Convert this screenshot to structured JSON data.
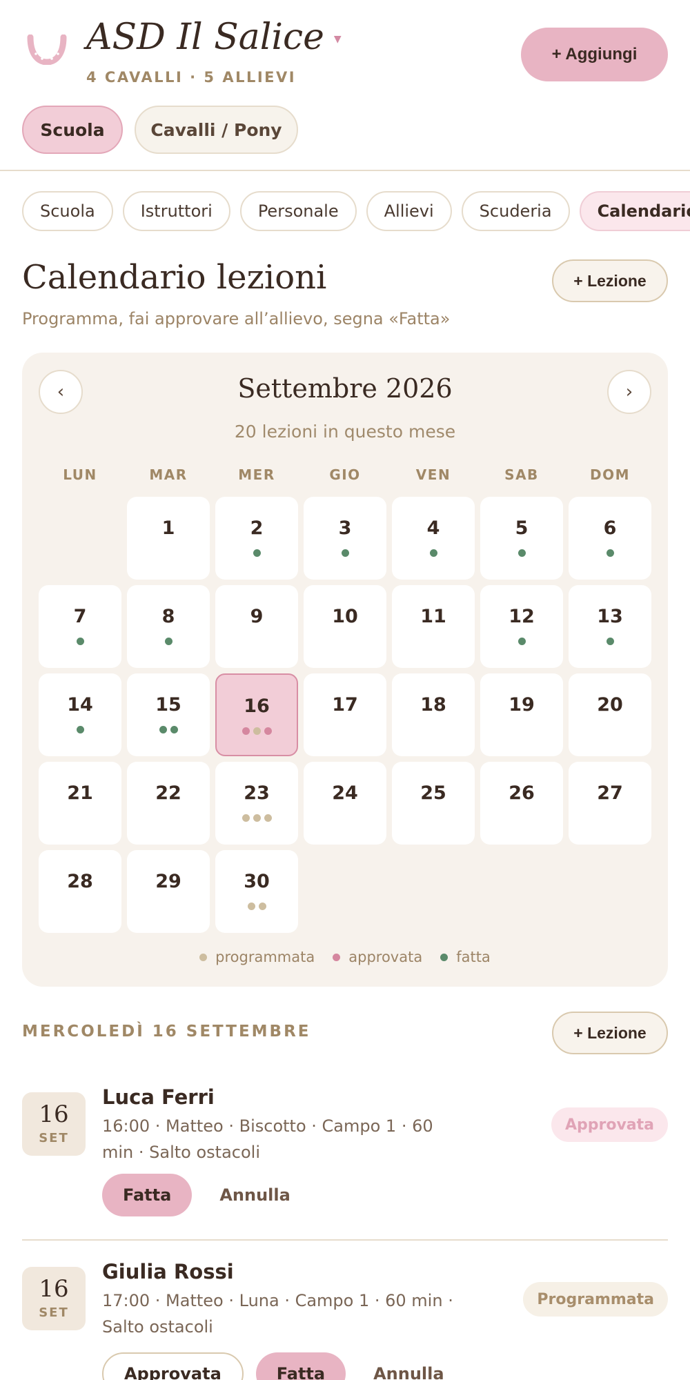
{
  "header": {
    "title": "ASD Il Salice",
    "subtitle": "4 CAVALLI · 5 ALLIEVI",
    "add_button": "+ Aggiungi",
    "segments": [
      "Scuola",
      "Cavalli / Pony"
    ]
  },
  "nav": [
    "Scuola",
    "Istruttori",
    "Personale",
    "Allievi",
    "Scuderia",
    "Calendario"
  ],
  "page": {
    "title": "Calendario lezioni",
    "subtitle": "Programma, fai approvare all’allievo, segna «Fatta»",
    "add_lesson": "+ Lezione"
  },
  "calendar": {
    "prev": "‹",
    "next": "›",
    "month": "Settembre 2026",
    "count": "20 lezioni in questo mese",
    "weekdays": [
      "LUN",
      "MAR",
      "MER",
      "GIO",
      "VEN",
      "SAB",
      "DOM"
    ],
    "leading_blanks": 1,
    "today": 16,
    "days": [
      {
        "n": "1",
        "dots": []
      },
      {
        "n": "2",
        "dots": [
          "fatta"
        ]
      },
      {
        "n": "3",
        "dots": [
          "fatta"
        ]
      },
      {
        "n": "4",
        "dots": [
          "fatta"
        ]
      },
      {
        "n": "5",
        "dots": [
          "fatta"
        ]
      },
      {
        "n": "6",
        "dots": [
          "fatta"
        ]
      },
      {
        "n": "7",
        "dots": [
          "fatta"
        ]
      },
      {
        "n": "8",
        "dots": [
          "fatta"
        ]
      },
      {
        "n": "9",
        "dots": []
      },
      {
        "n": "10",
        "dots": []
      },
      {
        "n": "11",
        "dots": []
      },
      {
        "n": "12",
        "dots": [
          "fatta"
        ]
      },
      {
        "n": "13",
        "dots": [
          "fatta"
        ]
      },
      {
        "n": "14",
        "dots": [
          "fatta"
        ]
      },
      {
        "n": "15",
        "dots": [
          "fatta",
          "fatta"
        ]
      },
      {
        "n": "16",
        "dots": [
          "approvata",
          "programmata",
          "approvata"
        ]
      },
      {
        "n": "17",
        "dots": []
      },
      {
        "n": "18",
        "dots": []
      },
      {
        "n": "19",
        "dots": []
      },
      {
        "n": "20",
        "dots": []
      },
      {
        "n": "21",
        "dots": []
      },
      {
        "n": "22",
        "dots": []
      },
      {
        "n": "23",
        "dots": [
          "programmata",
          "programmata",
          "programmata"
        ]
      },
      {
        "n": "24",
        "dots": []
      },
      {
        "n": "25",
        "dots": []
      },
      {
        "n": "26",
        "dots": []
      },
      {
        "n": "27",
        "dots": []
      },
      {
        "n": "28",
        "dots": []
      },
      {
        "n": "29",
        "dots": []
      },
      {
        "n": "30",
        "dots": [
          "programmata",
          "programmata"
        ]
      }
    ],
    "legend": [
      {
        "key": "programmata",
        "label": "programmata"
      },
      {
        "key": "approvata",
        "label": "approvata"
      },
      {
        "key": "fatta",
        "label": "fatta"
      }
    ],
    "colors": {
      "programmata": "#cdbd9f",
      "approvata": "#d5879f",
      "fatta": "#5a8a6a"
    }
  },
  "day_section": {
    "heading": "MERCOLEDÌ 16 SETTEMBRE",
    "add_lesson": "+ Lezione",
    "lessons": [
      {
        "day": "16",
        "month": "SET",
        "name": "Luca Ferri",
        "detail": "16:00 · Matteo · Biscotto · Campo 1 · 60 min · Salto ostacoli",
        "status": "Approvata",
        "actions": [
          "Fatta",
          "Annulla"
        ]
      },
      {
        "day": "16",
        "month": "SET",
        "name": "Giulia Rossi",
        "detail": "17:00 · Matteo · Luna · Campo 1 · 60 min · Salto ostacoli",
        "status": "Programmata",
        "actions": [
          "Approvata",
          "Fatta",
          "Annulla"
        ]
      }
    ]
  }
}
